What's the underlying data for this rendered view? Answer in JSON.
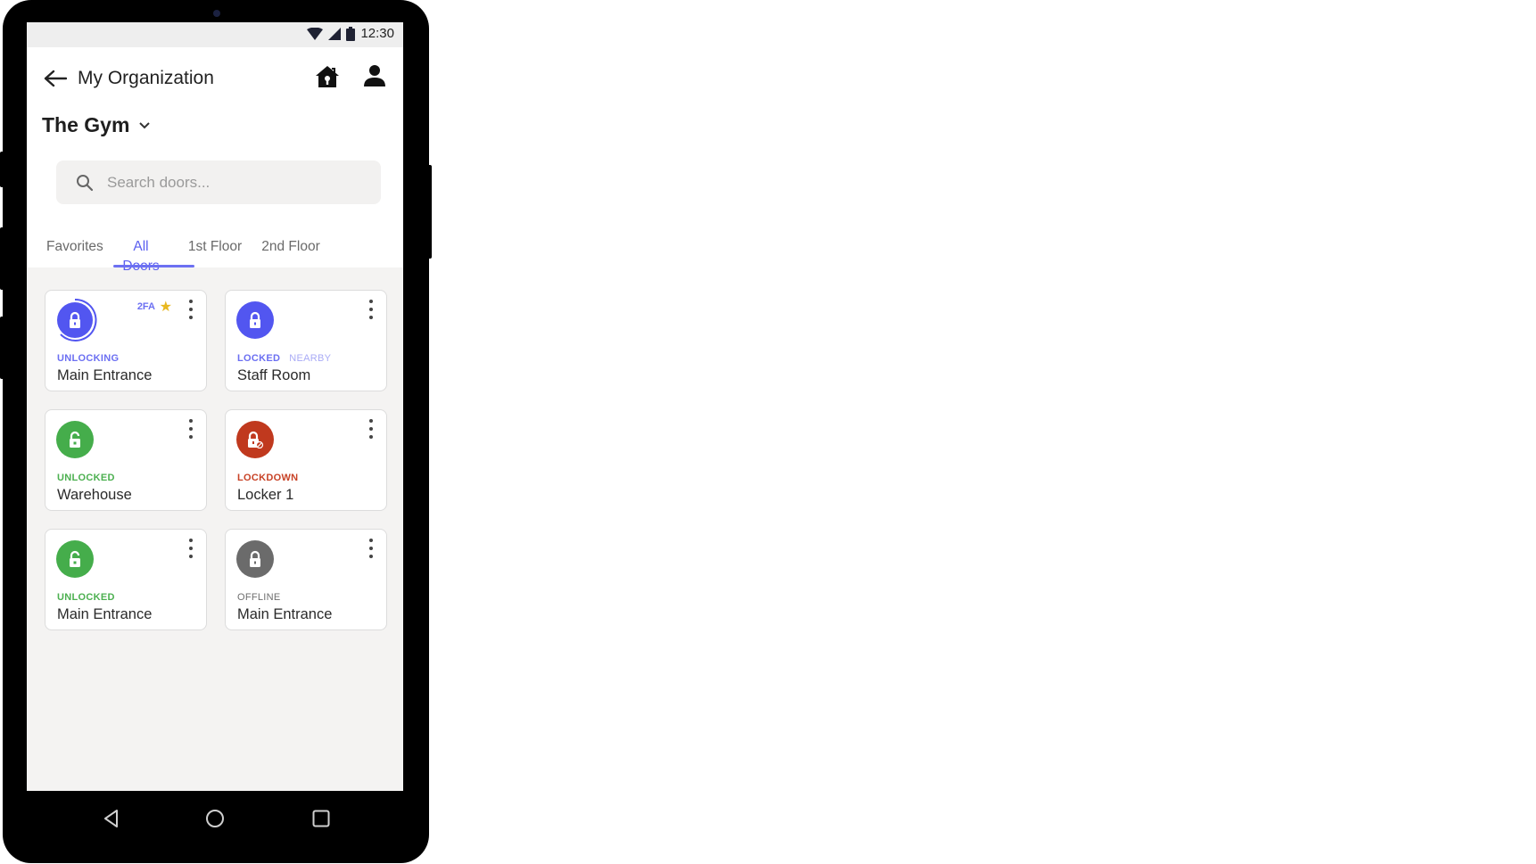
{
  "status_bar": {
    "time": "12:30",
    "icons": [
      "wifi-icon",
      "cell-signal-icon",
      "battery-icon"
    ]
  },
  "header": {
    "back_icon": "arrow-left-icon",
    "title": "My Organization",
    "home_icon": "home-lock-icon",
    "profile_icon": "person-icon"
  },
  "site": {
    "name": "The Gym",
    "dropdown_icon": "chevron-down-icon"
  },
  "search": {
    "placeholder": "Search doors...",
    "value": ""
  },
  "tabs": [
    {
      "label": "Favorites",
      "active": false
    },
    {
      "label": "All Doors",
      "active": true
    },
    {
      "label": "1st Floor",
      "active": false
    },
    {
      "label": "2nd Floor",
      "active": false
    }
  ],
  "colors": {
    "accent": "#5a5ef0",
    "locked": "#5256f0",
    "unlocked": "#45ad4b",
    "lockdown": "#c0391e",
    "offline": "#6b6b6b"
  },
  "doors": [
    {
      "name": "Main Entrance",
      "status": "UNLOCKING",
      "status_color": "#6b6ff2",
      "extra_tag": "",
      "badge": "2FA",
      "favorite": true,
      "icon": "lock-icon",
      "circle_color": "#5256f0"
    },
    {
      "name": "Staff Room",
      "status": "LOCKED",
      "status_color": "#6b6ff2",
      "extra_tag": "NEARBY",
      "badge": "",
      "favorite": false,
      "icon": "lock-icon",
      "circle_color": "#5256f0"
    },
    {
      "name": "Warehouse",
      "status": "UNLOCKED",
      "status_color": "#4cb050",
      "extra_tag": "",
      "badge": "",
      "favorite": false,
      "icon": "lock-open-icon",
      "circle_color": "#45ad4b"
    },
    {
      "name": "Locker 1",
      "status": "LOCKDOWN",
      "status_color": "#c84226",
      "extra_tag": "",
      "badge": "",
      "favorite": false,
      "icon": "lock-blocked-icon",
      "circle_color": "#c0391e"
    },
    {
      "name": "Main Entrance",
      "status": "UNLOCKED",
      "status_color": "#4cb050",
      "extra_tag": "",
      "badge": "",
      "favorite": false,
      "icon": "lock-open-icon",
      "circle_color": "#45ad4b"
    },
    {
      "name": "Main Entrance",
      "status": "OFFLINE",
      "status_color": "#6e6e6e",
      "extra_tag": "",
      "badge": "",
      "favorite": false,
      "icon": "lock-icon",
      "circle_color": "#6b6b6b"
    }
  ],
  "nav_bar": {
    "back": "nav-back-icon",
    "home": "nav-home-icon",
    "recents": "nav-recents-icon"
  }
}
